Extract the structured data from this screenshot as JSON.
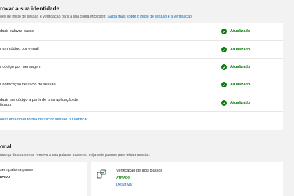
{
  "identity": {
    "title": "rovar a sua identidade",
    "desc_text": "ões de início de sessão e verificação para a sua conta Microsoft.",
    "desc_link": "Saiba mais sobre o início de sessão e a verificação.",
    "methods": [
      {
        "label_lines": [
          "duzir palavra-passe"
        ],
        "status": "Atualizado"
      },
      {
        "label_lines": [
          "r um código por e-mail"
        ],
        "status": "Atualizado"
      },
      {
        "label_lines": [
          "r código por mensagem"
        ],
        "status": "Atualizado"
      },
      {
        "label_lines": [
          "r notificação de início de sessão"
        ],
        "status": "Atualizado"
      },
      {
        "label_lines": [
          "duzir um código a partir de uma aplicação de",
          "ticador"
        ],
        "status": "Atualizado"
      }
    ],
    "add_method_link": "onar uma nova forma de iniciar sessão ou verificar"
  },
  "additional": {
    "title": "onal",
    "desc": "urança da sua conta, remova a sua palavra-passe ou exija dois passos para iniciar sessão.",
    "passwordless": {
      "title": "sem palavra-passe",
      "state": "IVADO"
    },
    "two_step": {
      "title": "Verificação de dois passos",
      "state": "ATIVADO",
      "action": "Desativar"
    }
  },
  "colors": {
    "accent": "#0067b8",
    "success": "#107c10",
    "background": "#f2f2f2",
    "card": "#ffffff"
  },
  "icons": {
    "status": "check-circle-icon",
    "two_step": "two-step-verification-icon"
  }
}
